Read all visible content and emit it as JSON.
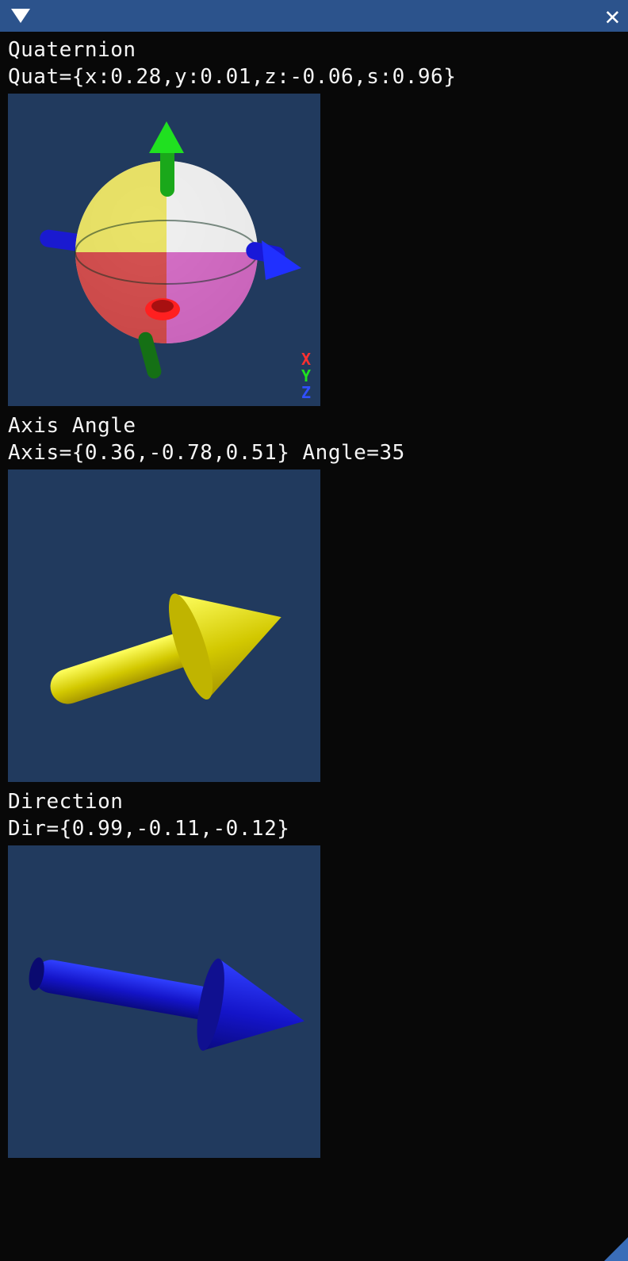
{
  "sections": {
    "quaternion": {
      "title": "Quaternion",
      "value": "Quat={x:0.28,y:0.01,z:-0.06,s:0.96}",
      "axis_legend": {
        "x": "X",
        "y": "Y",
        "z": "Z"
      }
    },
    "axis_angle": {
      "title": "Axis Angle",
      "value": "Axis={0.36,-0.78,0.51} Angle=35"
    },
    "direction": {
      "title": "Direction",
      "value": "Dir={0.99,-0.11,-0.12}"
    }
  },
  "colors": {
    "panel_bg": "#213a5e",
    "titlebar": "#2c538c",
    "axis_x": "#ff3030",
    "axis_y": "#20e020",
    "axis_z": "#3050ff",
    "arrow_yellow": "#e2d400",
    "arrow_blue": "#1818d8"
  }
}
